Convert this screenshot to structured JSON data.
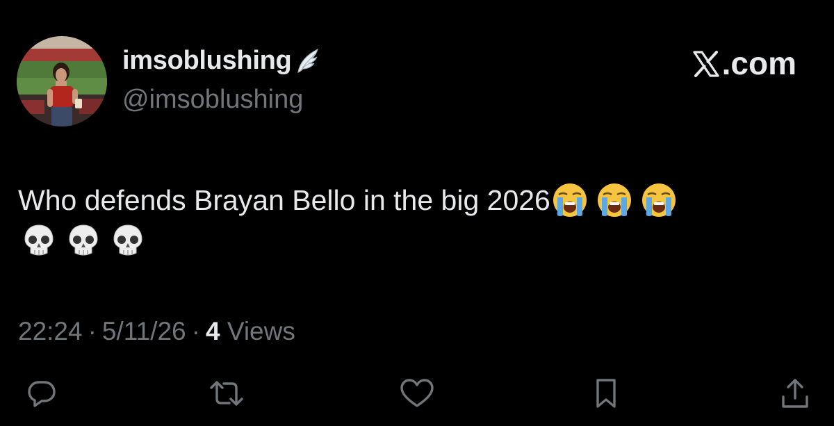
{
  "author": {
    "display_name": "imsoblushing",
    "badge_icon": "angel-wing-icon",
    "handle": "@imsoblushing"
  },
  "brand": {
    "logo_icon": "x-logo-icon",
    "label": ".com"
  },
  "tweet": {
    "text": "Who defends Brayan Bello in the big 2026",
    "emojis_line1": [
      "loudly-crying-face-icon",
      "loudly-crying-face-icon",
      "loudly-crying-face-icon"
    ],
    "emojis_line2": [
      "skull-icon",
      "skull-icon",
      "skull-icon"
    ]
  },
  "meta": {
    "time": "22:24",
    "separator": "·",
    "date": "5/11/26",
    "views_count": "4",
    "views_label": "Views"
  },
  "actions": [
    "reply-icon",
    "retweet-icon",
    "like-icon",
    "bookmark-icon",
    "share-icon"
  ],
  "colors": {
    "background": "#000000",
    "text_primary": "#e7e9ea",
    "text_secondary": "#71767b"
  }
}
